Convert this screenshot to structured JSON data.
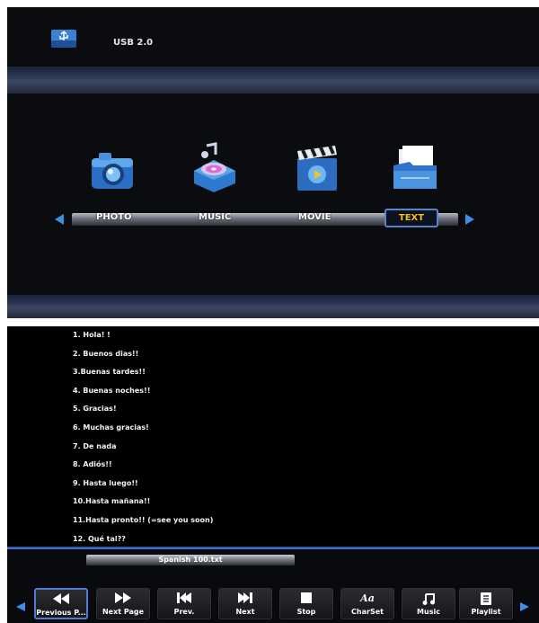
{
  "menu": {
    "device_label": "USB 2.0",
    "categories": [
      {
        "label": "PHOTO",
        "icon": "camera-icon"
      },
      {
        "label": "MUSIC",
        "icon": "music-disc-icon"
      },
      {
        "label": "MOVIE",
        "icon": "clapperboard-icon"
      },
      {
        "label": "TEXT",
        "icon": "document-folder-icon"
      }
    ],
    "selected_category": "TEXT",
    "accent_color": "#5b84c8",
    "selected_text_color": "#f0c21c"
  },
  "text_viewer": {
    "lines": [
      "1. Hola! !",
      "2. Buenos dias!!",
      "3.Buenas tardes!!",
      "4. Buenas noches!!",
      "5. Gracias!",
      "6. Muchas gracias!",
      "7. De nada",
      "8. Adiós!!",
      "9. Hasta luego!!",
      "10.Hasta mañana!!",
      "11.Hasta pronto!! (=see you soon)",
      "12. Qué tal??"
    ],
    "file_name": "Spanish 100.txt"
  },
  "toolbar": {
    "buttons": [
      {
        "label": "Previous P...",
        "icon": "rewind-icon",
        "selected": true
      },
      {
        "label": "Next Page",
        "icon": "fast-forward-icon"
      },
      {
        "label": "Prev.",
        "icon": "skip-previous-icon"
      },
      {
        "label": "Next",
        "icon": "skip-next-icon"
      },
      {
        "label": "Stop",
        "icon": "stop-icon"
      },
      {
        "label": "CharSet",
        "icon": "charset-icon"
      },
      {
        "label": "Music",
        "icon": "music-note-icon"
      },
      {
        "label": "Playlist",
        "icon": "playlist-icon"
      }
    ]
  }
}
